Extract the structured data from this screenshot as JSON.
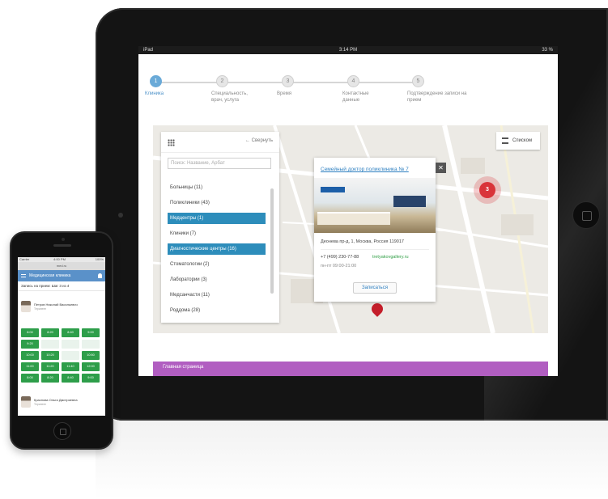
{
  "ipad": {
    "status": {
      "carrier": "iPad",
      "time": "3:14 PM",
      "battery": "33 %"
    },
    "steps": [
      {
        "num": "1",
        "label": "Клиника",
        "active": true
      },
      {
        "num": "2",
        "label": "Специальность, врач, услуга",
        "active": false
      },
      {
        "num": "3",
        "label": "Время",
        "active": false
      },
      {
        "num": "4",
        "label": "Контактные данные",
        "active": false
      },
      {
        "num": "5",
        "label": "Подтверждение записи на прием",
        "active": false
      }
    ],
    "panel": {
      "collapse_label": "← Свернуть",
      "search_placeholder": "Поиск: Название, Арбат",
      "categories": [
        {
          "label": "Больницы (11)",
          "selected": false
        },
        {
          "label": "Поликлиники (43)",
          "selected": false
        },
        {
          "label": "Медцентры (1)",
          "selected": true
        },
        {
          "label": "Клиники (7)",
          "selected": false
        },
        {
          "label": "Диагностические центры (16)",
          "selected": true
        },
        {
          "label": "Стоматологии (2)",
          "selected": false
        },
        {
          "label": "Лаборатории (3)",
          "selected": false
        },
        {
          "label": "Медсанчасти (11)",
          "selected": false
        },
        {
          "label": "Роддома (28)",
          "selected": false
        }
      ]
    },
    "list_button": "Списком",
    "popup": {
      "title": "Семейный доктор поликлиника № 7",
      "address": "Деонева пр-д, 1, Москва, Россия 119017",
      "phone": "+7 (499) 230-77-88",
      "site": "tretyakovgallery.ru",
      "hours": "пн-пт 09:00-21:00",
      "enroll_button": "Записаться",
      "close": "✕"
    },
    "cluster_count": "3",
    "bottom_bar": "Главная страница"
  },
  "iphone": {
    "status": {
      "left": "Carrier",
      "time": "4:00 PM",
      "right": "100%"
    },
    "url": "med.ru",
    "header_title": "Медицинская клиника",
    "subheader": "Запись на прием: Шаг 3 из 4",
    "doctors": [
      {
        "name": "Петров Николай Васильевич",
        "role": "Терапевт"
      },
      {
        "name": "Краснова Ольга Дмитриевна",
        "role": "Терапевт"
      }
    ],
    "slots": [
      "8:00",
      "8:20",
      "8:40",
      "9:00",
      "9:20",
      "",
      "",
      "",
      "10:00",
      "10:20",
      "",
      "10:50",
      "11:00",
      "11:20",
      "11:40",
      "12:00",
      "8:00",
      "8:20",
      "8:40",
      "9:00"
    ]
  }
}
